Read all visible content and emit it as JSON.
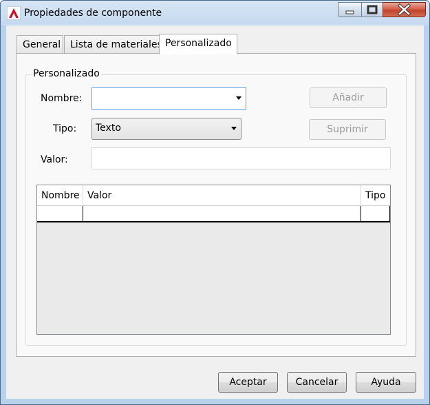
{
  "window": {
    "title": "Propiedades de componente"
  },
  "tabs": [
    {
      "label": "General"
    },
    {
      "label": "Lista de materiales"
    },
    {
      "label": "Personalizado",
      "active": true
    }
  ],
  "group": {
    "legend": "Personalizado",
    "nombre_label": "Nombre:",
    "nombre_value": "",
    "tipo_label": "Tipo:",
    "tipo_value": "Texto",
    "valor_label": "Valor:",
    "valor_value": "",
    "add_button": "Añadir",
    "delete_button": "Suprimir"
  },
  "grid": {
    "columns": [
      "Nombre",
      "Valor",
      "Tipo"
    ],
    "rows": [
      [
        "",
        "",
        ""
      ]
    ]
  },
  "footer": {
    "accept": "Aceptar",
    "cancel": "Cancelar",
    "help": "Ayuda"
  },
  "colors": {
    "frame": "#b9d1ea",
    "close_button": "#c7472f",
    "focus_border": "#569de5"
  }
}
